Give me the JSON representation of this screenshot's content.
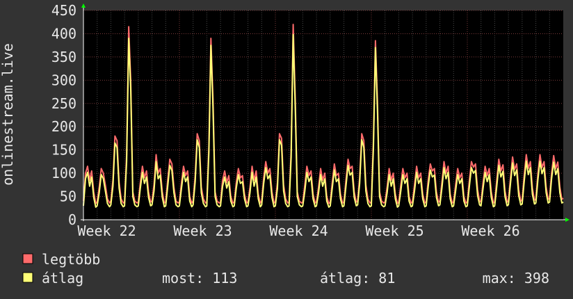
{
  "chart_data": {
    "type": "line",
    "ylabel": "onlinestream.live",
    "ylim": [
      0,
      450
    ],
    "yticks": [
      "0",
      "50",
      "100",
      "150",
      "200",
      "250",
      "300",
      "350",
      "400",
      "450"
    ],
    "xticks": [
      "Week 22",
      "Week 23",
      "Week 24",
      "Week 25",
      "Week 26"
    ],
    "grid": true,
    "x_range_days": [
      0,
      35
    ],
    "series": [
      {
        "name": "legtöbb",
        "color": "#ff6b6b",
        "x": [
          0.0,
          0.15,
          0.3,
          0.45,
          0.6,
          0.75,
          0.9,
          1.0,
          1.15,
          1.3,
          1.45,
          1.6,
          1.75,
          1.9,
          2.0,
          2.15,
          2.3,
          2.45,
          2.6,
          2.75,
          2.9,
          3.0,
          3.15,
          3.3,
          3.45,
          3.6,
          3.75,
          3.9,
          4.0,
          4.15,
          4.3,
          4.45,
          4.6,
          4.75,
          4.9,
          5.0,
          5.15,
          5.3,
          5.45,
          5.6,
          5.75,
          5.9,
          6.0,
          6.15,
          6.3,
          6.45,
          6.6,
          6.75,
          6.9,
          7.0,
          7.15,
          7.3,
          7.45,
          7.6,
          7.75,
          7.9,
          8.0,
          8.15,
          8.3,
          8.45,
          8.6,
          8.75,
          8.9,
          9.0,
          9.15,
          9.3,
          9.45,
          9.6,
          9.75,
          9.9,
          10.0,
          10.15,
          10.3,
          10.45,
          10.6,
          10.75,
          10.9,
          11.0,
          11.15,
          11.3,
          11.45,
          11.6,
          11.75,
          11.9,
          12.0,
          12.15,
          12.3,
          12.45,
          12.6,
          12.75,
          12.9,
          13.0,
          13.15,
          13.3,
          13.45,
          13.6,
          13.75,
          13.9,
          14.0,
          14.15,
          14.3,
          14.45,
          14.6,
          14.75,
          14.9,
          15.0,
          15.15,
          15.3,
          15.45,
          15.6,
          15.75,
          15.9,
          16.0,
          16.15,
          16.3,
          16.45,
          16.6,
          16.75,
          16.9,
          17.0,
          17.15,
          17.3,
          17.45,
          17.6,
          17.75,
          17.9,
          18.0,
          18.15,
          18.3,
          18.45,
          18.6,
          18.75,
          18.9,
          19.0,
          19.15,
          19.3,
          19.45,
          19.6,
          19.75,
          19.9,
          20.0,
          20.15,
          20.3,
          20.45,
          20.6,
          20.75,
          20.9,
          21.0,
          21.15,
          21.3,
          21.45,
          21.6,
          21.75,
          21.9,
          22.0,
          22.15,
          22.3,
          22.45,
          22.6,
          22.75,
          22.9,
          23.0,
          23.15,
          23.3,
          23.45,
          23.6,
          23.75,
          23.9,
          24.0,
          24.15,
          24.3,
          24.45,
          24.6,
          24.75,
          24.9,
          25.0,
          25.15,
          25.3,
          25.45,
          25.6,
          25.75,
          25.9,
          26.0,
          26.15,
          26.3,
          26.45,
          26.6,
          26.75,
          26.9,
          27.0,
          27.15,
          27.3,
          27.45,
          27.6,
          27.75,
          27.9,
          28.0,
          28.15,
          28.3,
          28.45,
          28.6,
          28.75,
          28.9,
          29.0,
          29.15,
          29.3,
          29.45,
          29.6,
          29.75,
          29.9,
          30.0,
          30.15,
          30.3,
          30.45,
          30.6,
          30.75,
          30.9,
          31.0,
          31.15,
          31.3,
          31.45,
          31.6,
          31.75,
          31.9,
          32.0,
          32.15,
          32.3,
          32.45,
          32.6,
          32.75,
          32.9,
          33.0,
          33.15,
          33.3,
          33.45,
          33.6,
          33.75,
          33.9,
          34.0,
          34.15,
          34.3,
          34.45,
          34.6,
          34.75,
          34.9,
          35.0
        ],
        "values": [
          40,
          100,
          115,
          85,
          105,
          60,
          35,
          38,
          70,
          110,
          100,
          75,
          45,
          36,
          40,
          85,
          180,
          170,
          80,
          45,
          36,
          38,
          140,
          415,
          300,
          60,
          40,
          36,
          38,
          80,
          115,
          90,
          105,
          60,
          38,
          40,
          75,
          140,
          100,
          110,
          60,
          36,
          38,
          85,
          130,
          120,
          70,
          40,
          36,
          38,
          80,
          115,
          95,
          105,
          50,
          36,
          40,
          95,
          185,
          170,
          70,
          45,
          36,
          38,
          160,
          390,
          260,
          60,
          40,
          36,
          38,
          85,
          105,
          80,
          95,
          50,
          36,
          38,
          80,
          110,
          90,
          95,
          55,
          36,
          38,
          70,
          115,
          85,
          105,
          55,
          36,
          40,
          90,
          125,
          100,
          110,
          60,
          36,
          38,
          80,
          185,
          175,
          75,
          45,
          36,
          38,
          150,
          420,
          260,
          60,
          40,
          36,
          38,
          75,
          115,
          95,
          105,
          55,
          36,
          38,
          70,
          110,
          85,
          100,
          50,
          35,
          38,
          80,
          120,
          95,
          100,
          55,
          36,
          38,
          85,
          130,
          110,
          115,
          60,
          38,
          40,
          90,
          185,
          170,
          75,
          45,
          36,
          38,
          170,
          385,
          250,
          60,
          40,
          36,
          38,
          70,
          110,
          85,
          100,
          55,
          35,
          38,
          75,
          110,
          90,
          100,
          50,
          36,
          38,
          75,
          115,
          90,
          100,
          55,
          36,
          38,
          85,
          120,
          105,
          110,
          60,
          38,
          40,
          80,
          125,
          100,
          115,
          55,
          36,
          38,
          75,
          110,
          90,
          100,
          50,
          36,
          38,
          85,
          125,
          113,
          120,
          65,
          40,
          38,
          80,
          115,
          95,
          110,
          60,
          36,
          38,
          85,
          130,
          105,
          118,
          62,
          38,
          40,
          90,
          135,
          108,
          120,
          65,
          40,
          42,
          95,
          140,
          110,
          125,
          68,
          42,
          44,
          98,
          140,
          112,
          125,
          70,
          44,
          46,
          100,
          138,
          110,
          124,
          70,
          44,
          46
        ],
        "summary": []
      },
      {
        "name": "átlag",
        "color": "#ffff77",
        "x": [
          0.0,
          0.15,
          0.3,
          0.45,
          0.6,
          0.75,
          0.9,
          1.0,
          1.15,
          1.3,
          1.45,
          1.6,
          1.75,
          1.9,
          2.0,
          2.15,
          2.3,
          2.45,
          2.6,
          2.75,
          2.9,
          3.0,
          3.15,
          3.3,
          3.45,
          3.6,
          3.75,
          3.9,
          4.0,
          4.15,
          4.3,
          4.45,
          4.6,
          4.75,
          4.9,
          5.0,
          5.15,
          5.3,
          5.45,
          5.6,
          5.75,
          5.9,
          6.0,
          6.15,
          6.3,
          6.45,
          6.6,
          6.75,
          6.9,
          7.0,
          7.15,
          7.3,
          7.45,
          7.6,
          7.75,
          7.9,
          8.0,
          8.15,
          8.3,
          8.45,
          8.6,
          8.75,
          8.9,
          9.0,
          9.15,
          9.3,
          9.45,
          9.6,
          9.75,
          9.9,
          10.0,
          10.15,
          10.3,
          10.45,
          10.6,
          10.75,
          10.9,
          11.0,
          11.15,
          11.3,
          11.45,
          11.6,
          11.75,
          11.9,
          12.0,
          12.15,
          12.3,
          12.45,
          12.6,
          12.75,
          12.9,
          13.0,
          13.15,
          13.3,
          13.45,
          13.6,
          13.75,
          13.9,
          14.0,
          14.15,
          14.3,
          14.45,
          14.6,
          14.75,
          14.9,
          15.0,
          15.15,
          15.3,
          15.45,
          15.6,
          15.75,
          15.9,
          16.0,
          16.15,
          16.3,
          16.45,
          16.6,
          16.75,
          16.9,
          17.0,
          17.15,
          17.3,
          17.45,
          17.6,
          17.75,
          17.9,
          18.0,
          18.15,
          18.3,
          18.45,
          18.6,
          18.75,
          18.9,
          19.0,
          19.15,
          19.3,
          19.45,
          19.6,
          19.75,
          19.9,
          20.0,
          20.15,
          20.3,
          20.45,
          20.6,
          20.75,
          20.9,
          21.0,
          21.15,
          21.3,
          21.45,
          21.6,
          21.75,
          21.9,
          22.0,
          22.15,
          22.3,
          22.45,
          22.6,
          22.75,
          22.9,
          23.0,
          23.15,
          23.3,
          23.45,
          23.6,
          23.75,
          23.9,
          24.0,
          24.15,
          24.3,
          24.45,
          24.6,
          24.75,
          24.9,
          25.0,
          25.15,
          25.3,
          25.45,
          25.6,
          25.75,
          25.9,
          26.0,
          26.15,
          26.3,
          26.45,
          26.6,
          26.75,
          26.9,
          27.0,
          27.15,
          27.3,
          27.45,
          27.6,
          27.75,
          27.9,
          28.0,
          28.15,
          28.3,
          28.45,
          28.6,
          28.75,
          28.9,
          29.0,
          29.15,
          29.3,
          29.45,
          29.6,
          29.75,
          29.9,
          30.0,
          30.15,
          30.3,
          30.45,
          30.6,
          30.75,
          30.9,
          31.0,
          31.15,
          31.3,
          31.45,
          31.6,
          31.75,
          31.9,
          32.0,
          32.15,
          32.3,
          32.45,
          32.6,
          32.75,
          32.9,
          33.0,
          33.15,
          33.3,
          33.45,
          33.6,
          33.75,
          33.9,
          34.0,
          34.15,
          34.3,
          34.45,
          34.6,
          34.75,
          34.9,
          35.0
        ],
        "values": [
          30,
          88,
          102,
          72,
          92,
          48,
          27,
          30,
          58,
          97,
          88,
          62,
          35,
          28,
          32,
          72,
          165,
          155,
          68,
          35,
          28,
          30,
          125,
          390,
          280,
          50,
          32,
          28,
          30,
          68,
          102,
          78,
          92,
          48,
          30,
          32,
          62,
          125,
          88,
          96,
          48,
          28,
          30,
          72,
          117,
          106,
          58,
          32,
          28,
          30,
          68,
          102,
          82,
          92,
          40,
          28,
          32,
          82,
          172,
          155,
          58,
          35,
          28,
          30,
          145,
          375,
          240,
          50,
          32,
          28,
          30,
          72,
          92,
          68,
          82,
          40,
          28,
          30,
          68,
          97,
          78,
          82,
          45,
          28,
          30,
          58,
          102,
          72,
          92,
          45,
          28,
          32,
          78,
          112,
          88,
          96,
          48,
          28,
          30,
          68,
          172,
          160,
          62,
          35,
          28,
          30,
          135,
          398,
          240,
          50,
          32,
          28,
          30,
          62,
          102,
          82,
          92,
          45,
          28,
          30,
          58,
          97,
          72,
          88,
          40,
          27,
          30,
          68,
          107,
          82,
          88,
          45,
          28,
          30,
          72,
          117,
          96,
          102,
          48,
          30,
          32,
          78,
          172,
          155,
          62,
          35,
          28,
          30,
          155,
          370,
          230,
          50,
          32,
          28,
          30,
          58,
          97,
          72,
          88,
          45,
          27,
          30,
          62,
          97,
          78,
          88,
          40,
          28,
          30,
          62,
          102,
          78,
          88,
          45,
          28,
          30,
          72,
          107,
          92,
          96,
          48,
          30,
          32,
          68,
          112,
          88,
          102,
          45,
          28,
          30,
          62,
          97,
          78,
          88,
          40,
          28,
          30,
          72,
          112,
          100,
          106,
          52,
          32,
          30,
          68,
          102,
          82,
          97,
          48,
          28,
          30,
          72,
          117,
          92,
          104,
          50,
          30,
          32,
          78,
          122,
          95,
          107,
          52,
          32,
          34,
          82,
          126,
          97,
          112,
          55,
          34,
          36,
          86,
          126,
          99,
          112,
          58,
          36,
          38,
          88,
          124,
          97,
          110,
          58,
          36,
          38
        ],
        "summary": [
          {
            "label": "most:",
            "value": "113"
          },
          {
            "label": "átlag:",
            "value": "81"
          },
          {
            "label": "max:",
            "value": "398"
          }
        ]
      }
    ]
  }
}
